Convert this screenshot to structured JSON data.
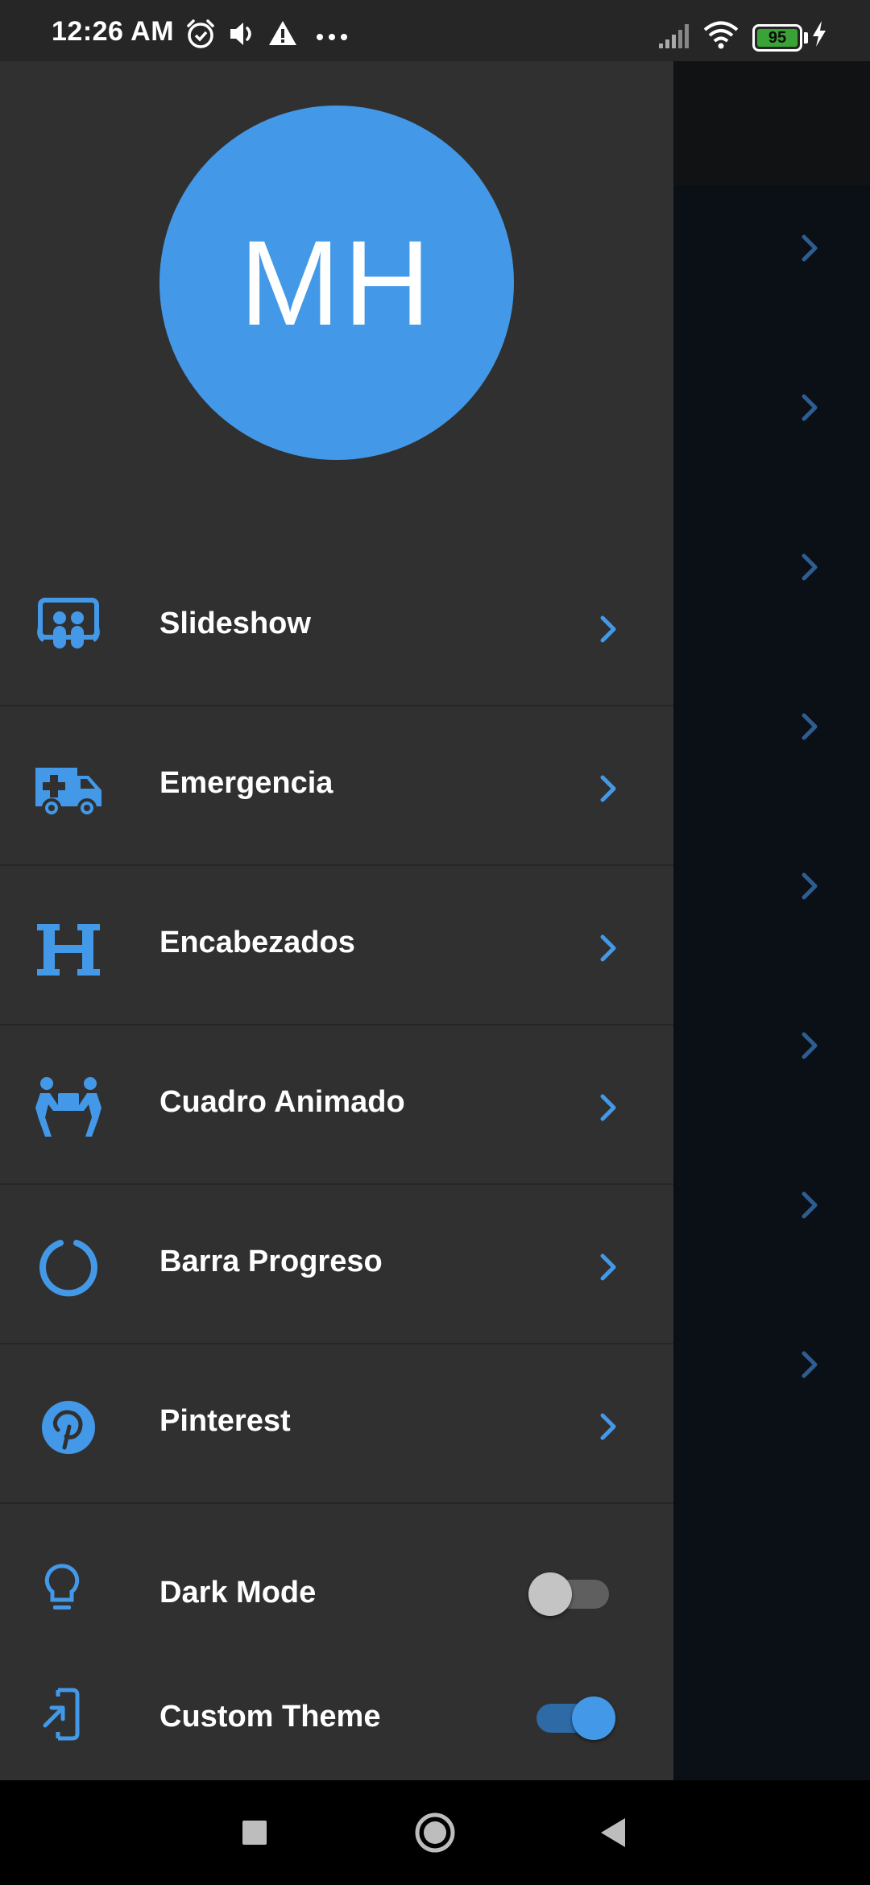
{
  "status_bar": {
    "time": "12:26 AM",
    "battery": "95",
    "icons": [
      "alarm-icon",
      "volume-icon",
      "warning-icon",
      "more-dots-icon",
      "signal-icon",
      "wifi-icon",
      "battery-icon",
      "charging-icon"
    ]
  },
  "drawer": {
    "avatar_initials": "MH",
    "menu_items": [
      {
        "label": "Slideshow",
        "icon": "slideshare-icon"
      },
      {
        "label": "Emergencia",
        "icon": "ambulance-icon"
      },
      {
        "label": "Encabezados",
        "icon": "heading-icon"
      },
      {
        "label": "Cuadro Animado",
        "icon": "people-carry-icon"
      },
      {
        "label": "Barra Progreso",
        "icon": "circle-notch-icon"
      },
      {
        "label": "Pinterest",
        "icon": "pinterest-icon"
      }
    ],
    "settings": {
      "dark_mode": {
        "label": "Dark Mode",
        "icon": "lightbulb-icon",
        "enabled": false
      },
      "custom_theme": {
        "label": "Custom Theme",
        "icon": "add-to-home-icon",
        "enabled": true
      }
    }
  },
  "colors": {
    "accent": "#4399e8",
    "drawer_bg": "#303030",
    "scrim_bg": "#0b1017"
  },
  "nav_bar": {
    "buttons": [
      "recents-square-icon",
      "home-circle-icon",
      "back-triangle-icon"
    ]
  }
}
